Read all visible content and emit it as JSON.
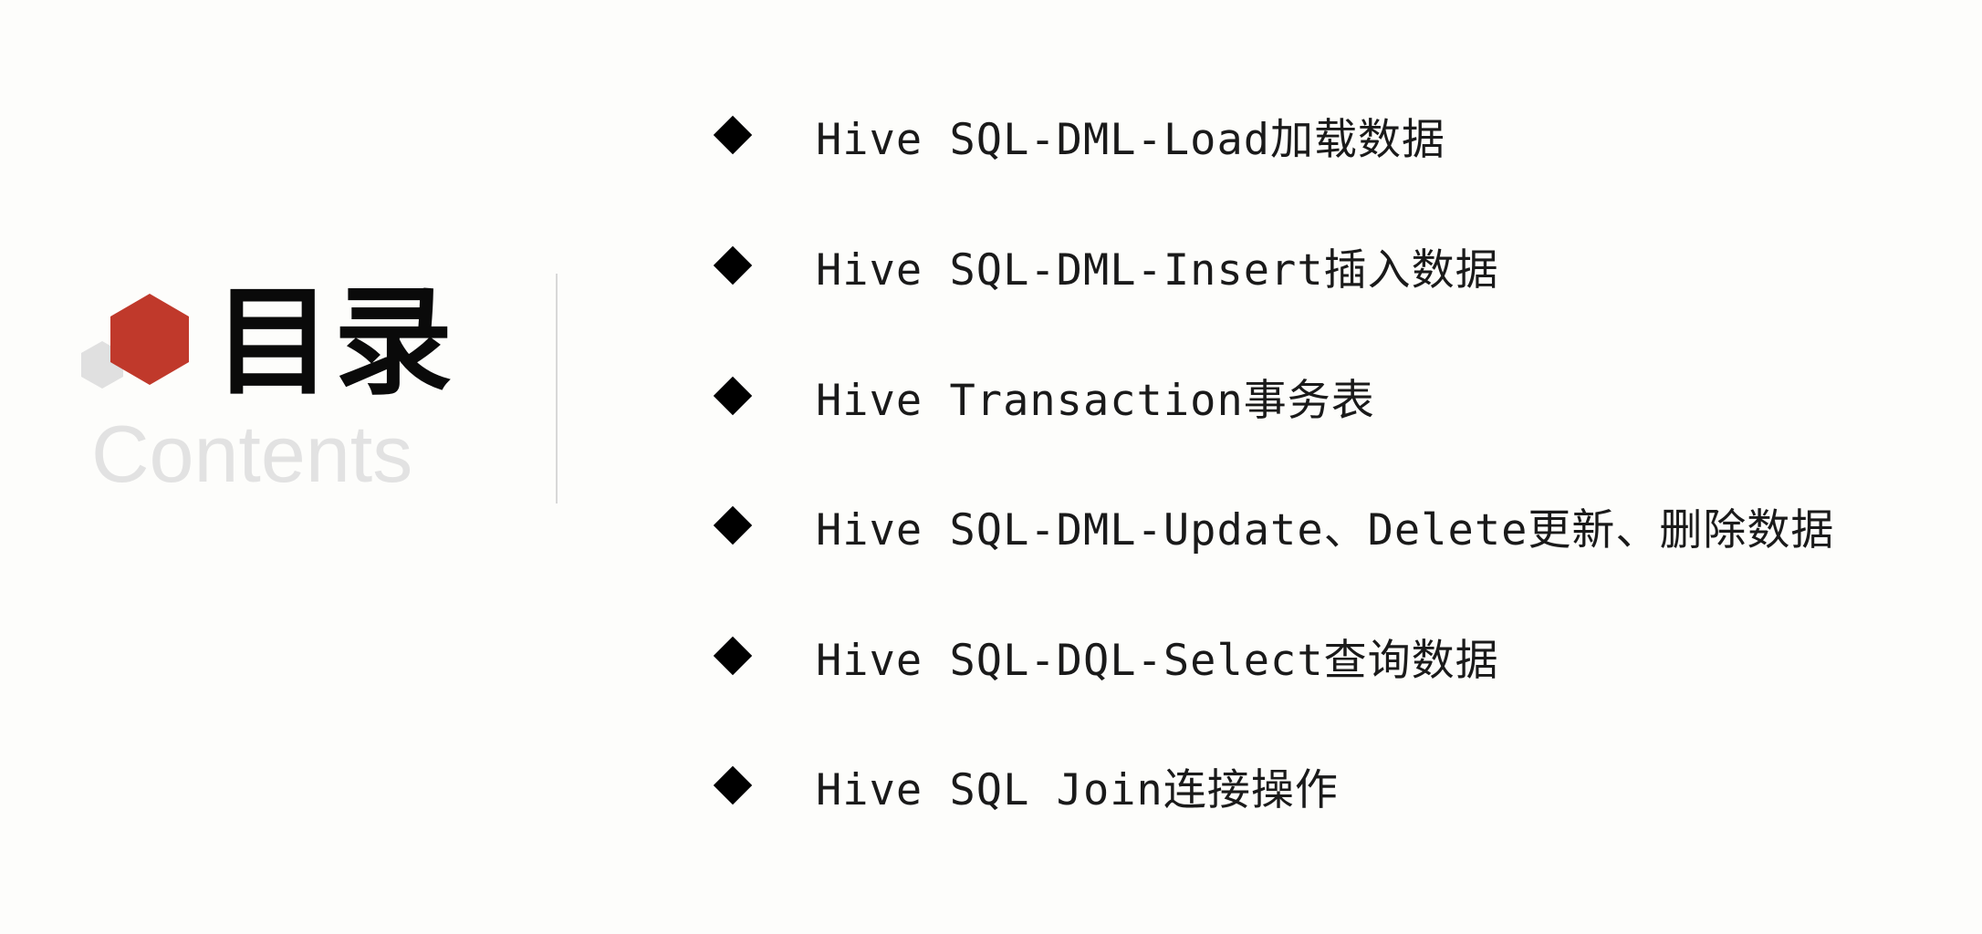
{
  "title": {
    "zh": "目录",
    "en": "Contents"
  },
  "colors": {
    "hex_primary": "#c0392b",
    "hex_secondary": "#e0e0e0",
    "title_text": "#0a0a0a",
    "subtitle_text": "#e2e2e2",
    "bullet": "#000000"
  },
  "icons": {
    "logo": "hexagon-logo-icon",
    "bullet": "diamond-bullet-icon"
  },
  "toc": [
    {
      "label": "Hive SQL-DML-Load加载数据"
    },
    {
      "label": "Hive SQL-DML-Insert插入数据"
    },
    {
      "label": "Hive Transaction事务表"
    },
    {
      "label": "Hive SQL-DML-Update、Delete更新、删除数据"
    },
    {
      "label": "Hive SQL-DQL-Select查询数据"
    },
    {
      "label": "Hive SQL Join连接操作"
    }
  ]
}
